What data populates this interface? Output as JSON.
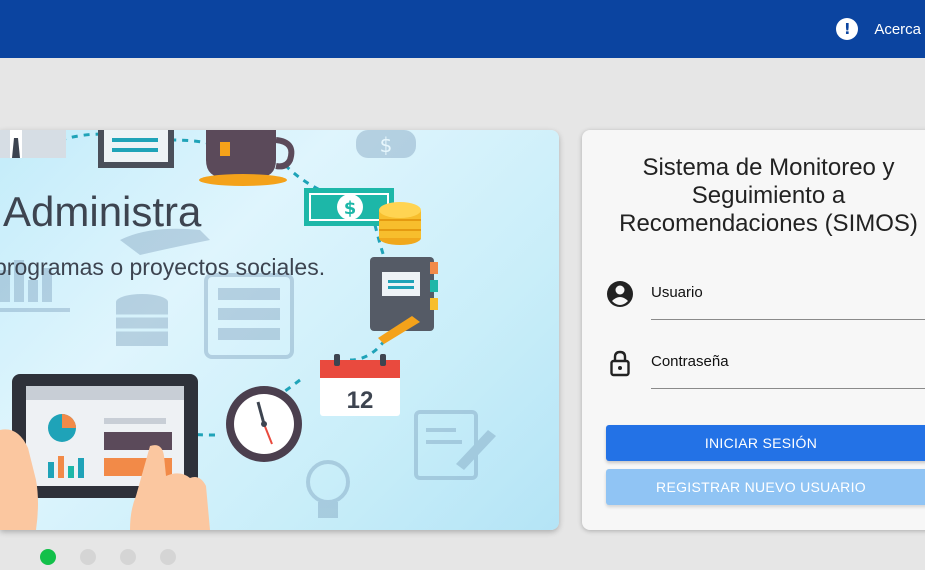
{
  "header": {
    "about_icon": "exclamation-circle-icon",
    "about_label": "Acerca"
  },
  "banner": {
    "title": "Administra",
    "subtitle": "programas o proyectos sociales.",
    "calendar_day": "12",
    "slides": [
      {
        "active": true
      },
      {
        "active": false
      },
      {
        "active": false
      },
      {
        "active": false
      }
    ]
  },
  "login": {
    "title_line1": "Sistema de Monitoreo y",
    "title_line2": "Seguimiento a",
    "title_line3": "Recomendaciones (SIMOS)",
    "username_label": "Usuario",
    "username_icon": "account-circle-icon",
    "password_label": "Contraseña",
    "password_icon": "lock-icon",
    "login_button": "INICIAR SESIÓN",
    "register_button": "REGISTRAR NUEVO USUARIO"
  },
  "colors": {
    "header": "#0b44a0",
    "primary_button": "#2372e6",
    "secondary_button": "#90c4f4",
    "active_dot": "#12c04a"
  }
}
